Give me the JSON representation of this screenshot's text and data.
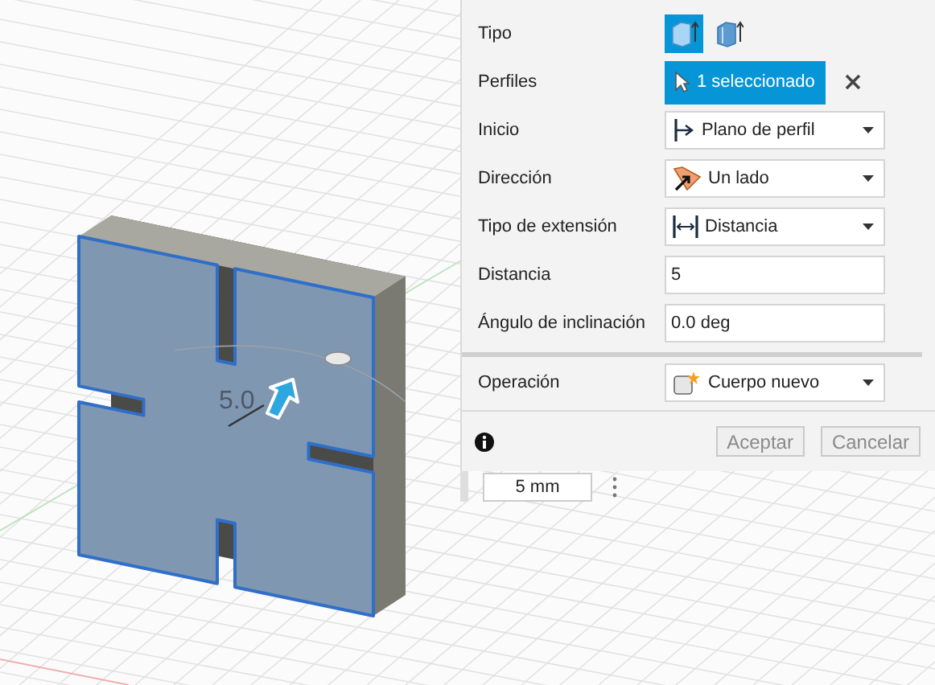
{
  "viewport": {
    "dimension_label": "5.0",
    "distance_field": {
      "value": "5 mm"
    }
  },
  "dialog": {
    "rows": [
      {
        "kind": "type",
        "label": "Tipo",
        "options": [
          {
            "selected": true
          },
          {
            "selected": false
          }
        ]
      },
      {
        "kind": "selection",
        "label": "Perfiles",
        "value": "1 seleccionado"
      },
      {
        "kind": "dropdown",
        "label": "Inicio",
        "value": "Plano de perfil"
      },
      {
        "kind": "dropdown",
        "label": "Dirección",
        "value": "Un lado"
      },
      {
        "kind": "dropdown",
        "label": "Tipo de extensión",
        "value": "Distancia"
      },
      {
        "kind": "input",
        "label": "Distancia",
        "value": "5"
      },
      {
        "kind": "input",
        "label": "Ángulo de inclinación",
        "value": "0.0 deg"
      }
    ],
    "operation": {
      "label": "Operación",
      "value": "Cuerpo nuevo"
    },
    "buttons": [
      "Aceptar",
      "Cancelar"
    ]
  }
}
